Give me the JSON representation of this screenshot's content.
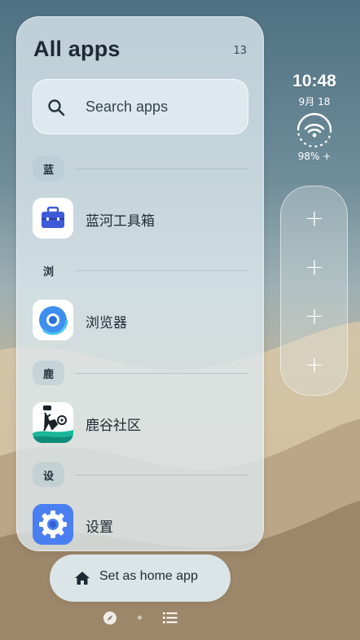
{
  "drawer": {
    "title": "All apps",
    "count": "13",
    "search_placeholder": "Search apps"
  },
  "sections": [
    {
      "letter": "蓝",
      "app": {
        "label": "蓝河工具箱",
        "icon": "toolbox-icon"
      }
    },
    {
      "letter": "浏",
      "app": {
        "label": "浏览器",
        "icon": "browser-icon"
      }
    },
    {
      "letter": "鹿",
      "app": {
        "label": "鹿谷社区",
        "icon": "deer-community-icon"
      }
    },
    {
      "letter": "设",
      "app": {
        "label": "设置",
        "icon": "settings-gear-icon"
      }
    }
  ],
  "status_widget": {
    "time": "10:48",
    "date": "9月 18",
    "battery": "98% +"
  },
  "shortcuts": [
    {
      "icon": "plus-icon",
      "label": "+"
    },
    {
      "icon": "plus-icon",
      "label": "+"
    },
    {
      "icon": "plus-icon",
      "label": "+"
    },
    {
      "icon": "plus-icon",
      "label": "+"
    }
  ],
  "home_button": {
    "label": "Set as home app",
    "icon": "home-icon"
  },
  "nav": {
    "left_icon": "compass-icon",
    "right_icon": "list-icon"
  },
  "colors": {
    "drawer_bg": "#dee9ee",
    "text_primary": "#1f2b33",
    "toolbox_bg": "#3e5ad8",
    "browser_blue": "#3d8ff0",
    "settings_blue": "#4a7ff2",
    "deer_teal": "#1ab69a"
  }
}
